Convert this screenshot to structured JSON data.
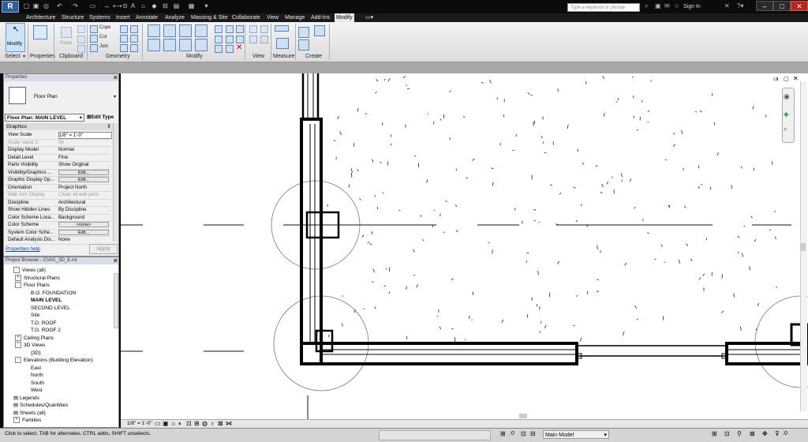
{
  "qat": {
    "text_icon": "A"
  },
  "search": {
    "placeholder": "Type a keyword or phrase"
  },
  "signin": "Sign In",
  "tabs": [
    "Architecture",
    "Structure",
    "Systems",
    "Insert",
    "Annotate",
    "Analyze",
    "Massing & Site",
    "Collaborate",
    "View",
    "Manage",
    "Add-Ins",
    "Modify"
  ],
  "ribbon": {
    "modify_label": "Modify",
    "panels": {
      "select": "Select",
      "properties": "Properties",
      "clipboard": "Clipboard",
      "geometry": "Geometry",
      "modify": "Modify",
      "view": "View",
      "measure": "Measure",
      "create": "Create"
    },
    "paste": "Paste",
    "cope": "Cope",
    "cut": "Cut",
    "join": "Join"
  },
  "properties": {
    "title": "Properties",
    "type_name": "Floor Plan",
    "selector": "Floor Plan: MAIN LEVEL",
    "edit_type": "Edit Type",
    "group": "Graphics",
    "rows": [
      {
        "k": "View Scale",
        "v": "1/8\" = 1'-0\""
      },
      {
        "k": "Scale Value    1:",
        "v": "96"
      },
      {
        "k": "Display Model",
        "v": "Normal"
      },
      {
        "k": "Detail Level",
        "v": "Fine"
      },
      {
        "k": "Parts Visibility",
        "v": "Show Original"
      },
      {
        "k": "Visibility/Graphics ...",
        "v": "Edit..."
      },
      {
        "k": "Graphic Display Op...",
        "v": "Edit..."
      },
      {
        "k": "Orientation",
        "v": "Project North"
      },
      {
        "k": "Wall Join Display",
        "v": "Clean all wall joins"
      },
      {
        "k": "Discipline",
        "v": "Architectural"
      },
      {
        "k": "Show Hidden Lines",
        "v": "By Discipline"
      },
      {
        "k": "Color Scheme Loca...",
        "v": "Background"
      },
      {
        "k": "Color Scheme",
        "v": "<none>"
      },
      {
        "k": "System Color Sche...",
        "v": "Edit..."
      },
      {
        "k": "Default Analysis Dis...",
        "v": "None"
      }
    ],
    "help": "Properties help",
    "apply": "Apply"
  },
  "browser": {
    "title": "Project Browser - CVAC_3D_E.rvt",
    "items": [
      {
        "t": "Views (all)",
        "lvl": 0,
        "exp": "-"
      },
      {
        "t": "Structural Plans",
        "lvl": 1,
        "exp": "+"
      },
      {
        "t": "Floor Plans",
        "lvl": 1,
        "exp": "-"
      },
      {
        "t": "B.O. FOUNDATION",
        "lvl": 2
      },
      {
        "t": "MAIN LEVEL",
        "lvl": 2,
        "bold": true
      },
      {
        "t": "SECOND LEVEL",
        "lvl": 2
      },
      {
        "t": "Site",
        "lvl": 2
      },
      {
        "t": "T.O. ROOF",
        "lvl": 2
      },
      {
        "t": "T.O. ROOF 2",
        "lvl": 2
      },
      {
        "t": "Ceiling Plans",
        "lvl": 1,
        "exp": "+"
      },
      {
        "t": "3D Views",
        "lvl": 1,
        "exp": "-"
      },
      {
        "t": "{3D}",
        "lvl": 2
      },
      {
        "t": "Elevations (Building Elevation)",
        "lvl": 1,
        "exp": "-"
      },
      {
        "t": "East",
        "lvl": 2
      },
      {
        "t": "North",
        "lvl": 2
      },
      {
        "t": "South",
        "lvl": 2
      },
      {
        "t": "West",
        "lvl": 2
      },
      {
        "t": "Legends",
        "lvl": 0
      },
      {
        "t": "Schedules/Quantities",
        "lvl": 0
      },
      {
        "t": "Sheets (all)",
        "lvl": 0
      },
      {
        "t": "Families",
        "lvl": 0,
        "exp": "+"
      }
    ]
  },
  "viewbar": {
    "scale": "1/8\" = 1'-0\""
  },
  "status": {
    "text": "Click to select, TAB for alternates, CTRL adds, SHIFT unselects.",
    "zero": ":0",
    "model": "Main Model"
  }
}
